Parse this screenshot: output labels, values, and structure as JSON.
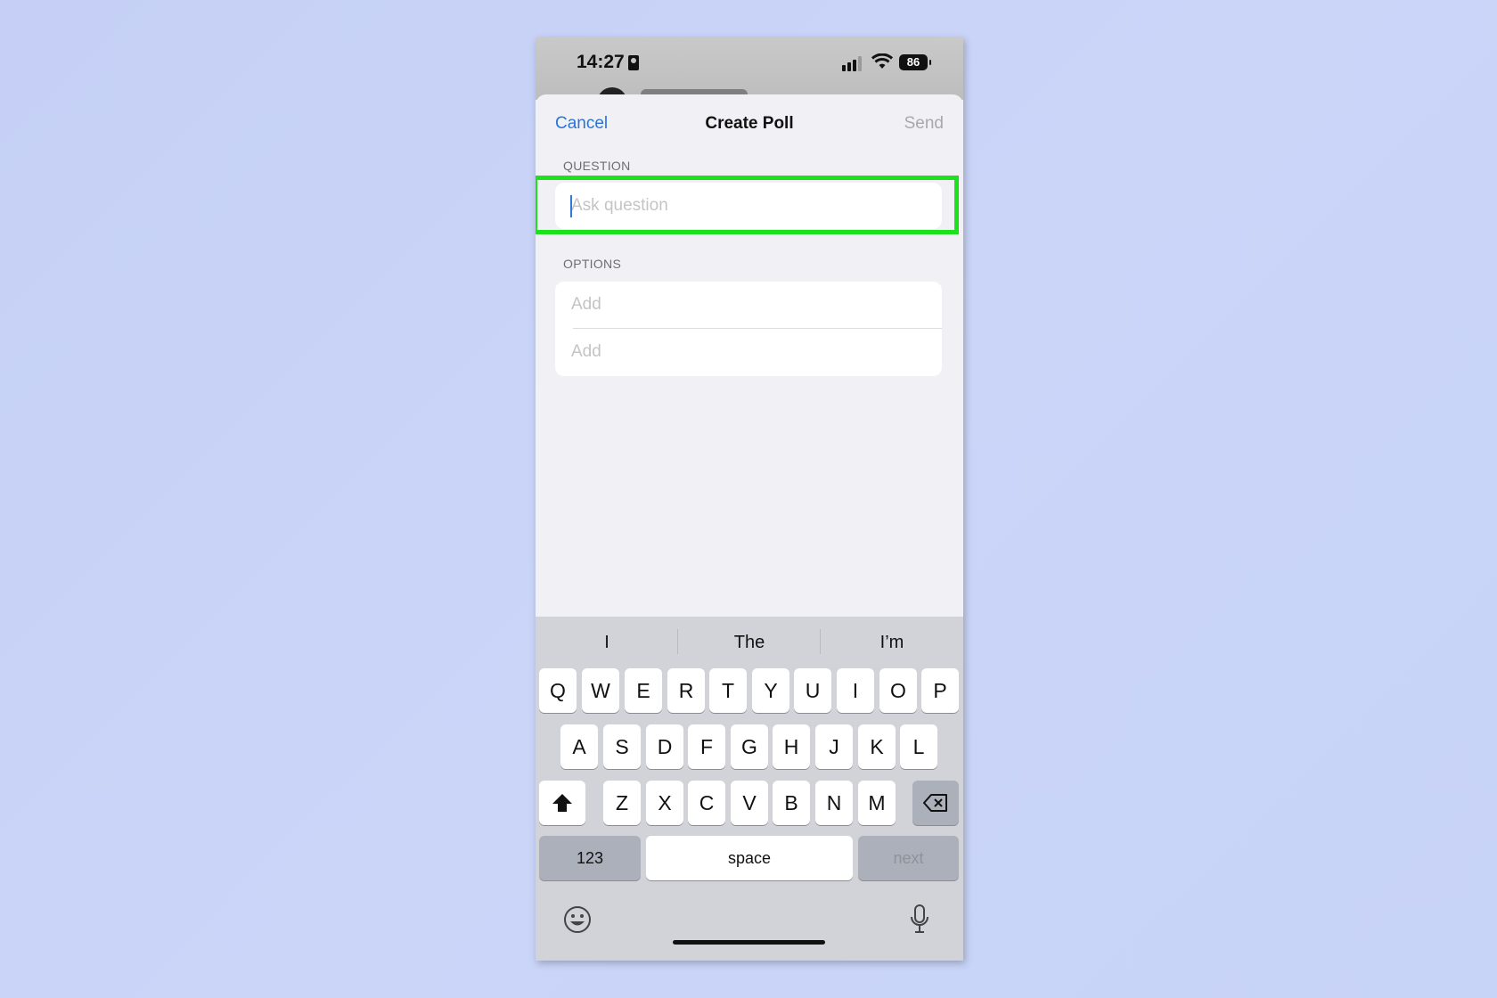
{
  "status_bar": {
    "time": "14:27",
    "battery": "86"
  },
  "nav": {
    "cancel": "Cancel",
    "title": "Create Poll",
    "send": "Send"
  },
  "question": {
    "label": "QUESTION",
    "placeholder": "Ask question"
  },
  "options": {
    "label": "OPTIONS",
    "items": [
      {
        "placeholder": "Add"
      },
      {
        "placeholder": "Add"
      }
    ]
  },
  "suggestions": [
    "I",
    "The",
    "I’m"
  ],
  "keyboard": {
    "row1": [
      "Q",
      "W",
      "E",
      "R",
      "T",
      "Y",
      "U",
      "I",
      "O",
      "P"
    ],
    "row2": [
      "A",
      "S",
      "D",
      "F",
      "G",
      "H",
      "J",
      "K",
      "L"
    ],
    "row3": [
      "Z",
      "X",
      "C",
      "V",
      "B",
      "N",
      "M"
    ],
    "numbers": "123",
    "space": "space",
    "next": "next"
  },
  "colors": {
    "accent": "#2a73d9",
    "highlight": "#1de11d"
  }
}
